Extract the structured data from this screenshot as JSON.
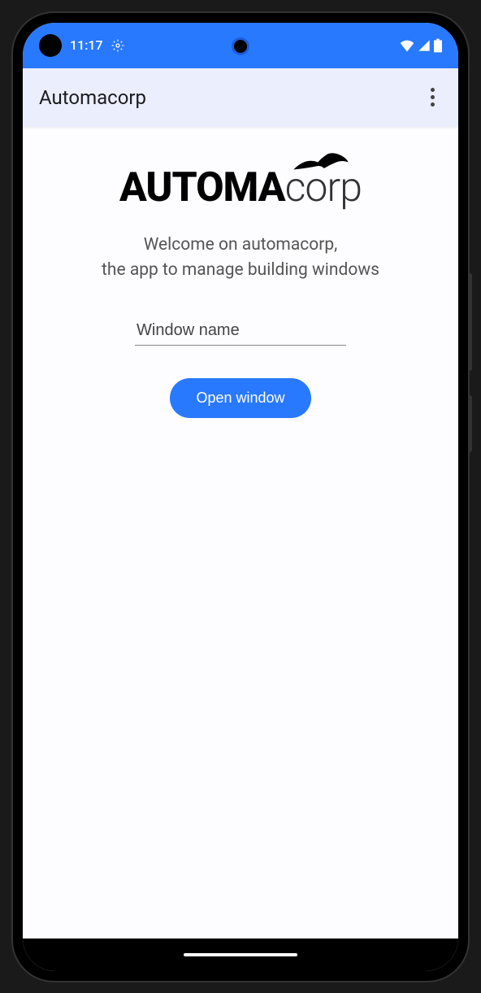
{
  "statusBar": {
    "time": "11:17"
  },
  "appBar": {
    "title": "Automacorp"
  },
  "logo": {
    "bold": "AUTOMA",
    "light": "corp"
  },
  "welcome": {
    "line1": "Welcome on automacorp,",
    "line2": "the app to manage building windows"
  },
  "input": {
    "placeholder": "Window name",
    "value": ""
  },
  "button": {
    "label": "Open window"
  },
  "colors": {
    "primary": "#2979ff",
    "appBarBg": "#ebeefc",
    "contentBg": "#fdfcff"
  }
}
